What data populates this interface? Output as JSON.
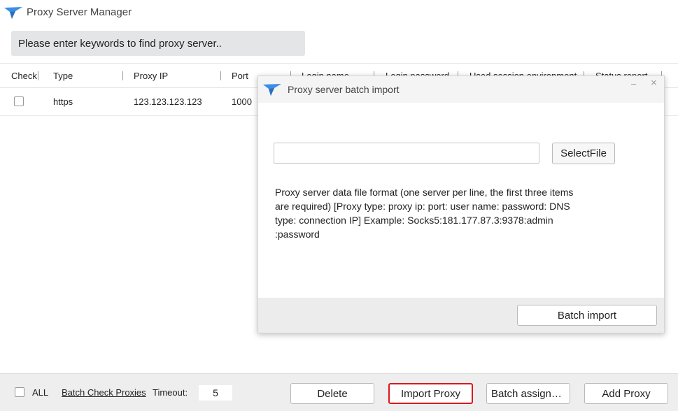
{
  "app": {
    "title": "Proxy Server Manager",
    "logo_icon": "bird-logo-icon",
    "accent": "#3a8ee6"
  },
  "search": {
    "placeholder": "Please enter keywords to find proxy server.."
  },
  "table": {
    "columns": [
      "Check",
      "Type",
      "Proxy IP",
      "Port",
      "Login name",
      "Login password",
      "Used session environment",
      "Status report"
    ],
    "rows": [
      {
        "type": "https",
        "ip": "123.123.123.123",
        "port": "1000"
      }
    ]
  },
  "footer": {
    "all_label": "ALL",
    "batch_check": "Batch Check Proxies",
    "timeout_label": "Timeout:",
    "timeout_value": "5",
    "buttons": {
      "delete": "Delete",
      "import_proxy": "Import Proxy",
      "batch_assign": "Batch assignm...",
      "add_proxy": "Add Proxy"
    },
    "highlight_color": "#e0151b"
  },
  "dialog": {
    "title": "Proxy server batch import",
    "minimize": "–",
    "close": "×",
    "file_path": "",
    "select_file": "SelectFile",
    "description": "Proxy server data file format (one server per line, the first three items are required) [Proxy type: proxy ip: port: user name: password: DNS type: connection IP] Example: Socks5:181.177.87.3:9378:admin :password",
    "batch_import": "Batch import"
  }
}
